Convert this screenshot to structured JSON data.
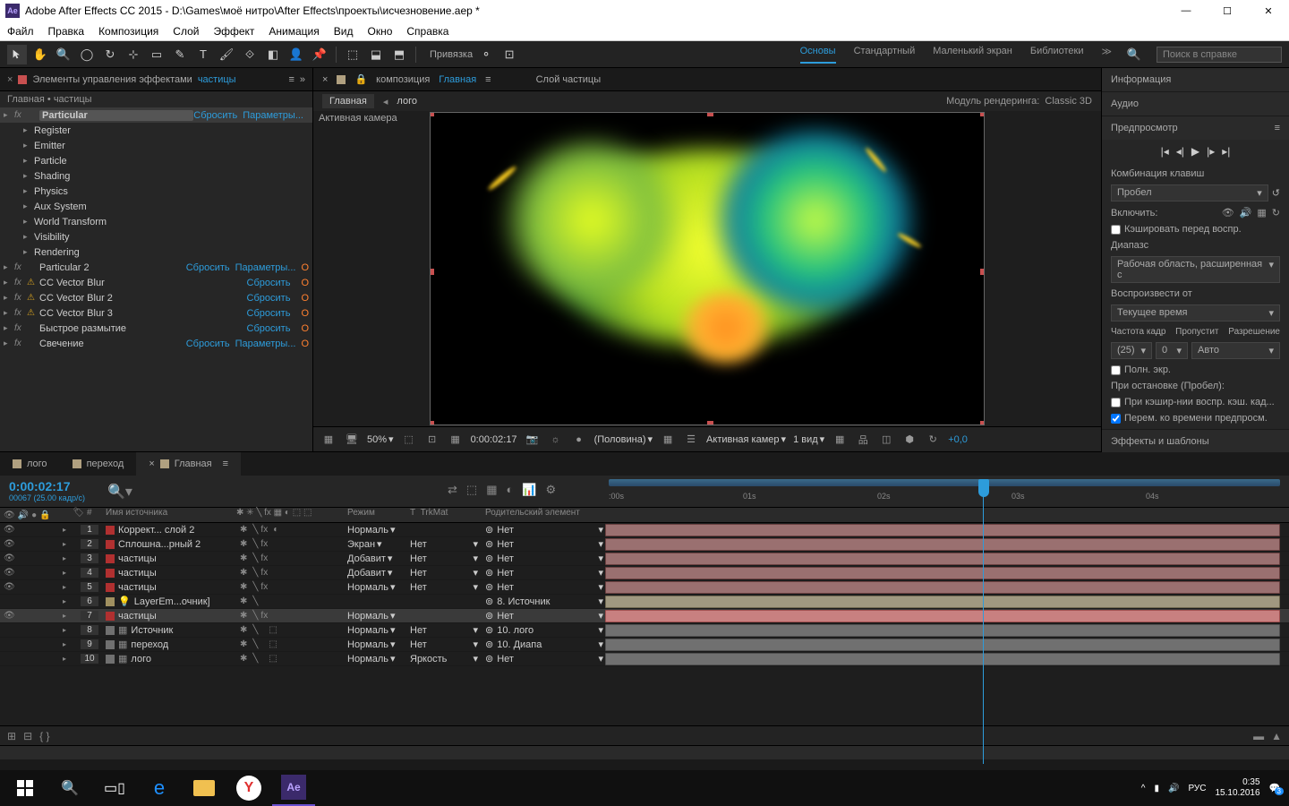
{
  "titlebar": {
    "app": "Adobe After Effects CC 2015",
    "path": "D:\\Games\\моё нитро\\After Effects\\проекты\\исчезновение.aep *"
  },
  "menu": [
    "Файл",
    "Правка",
    "Композиция",
    "Слой",
    "Эффект",
    "Анимация",
    "Вид",
    "Окно",
    "Справка"
  ],
  "toolrow": {
    "snap": "Привязка",
    "workspaces": [
      "Основы",
      "Стандартный",
      "Маленький экран",
      "Библиотеки"
    ],
    "ws_active": 0,
    "search_ph": "Поиск в справке"
  },
  "left": {
    "tab": "Элементы управления эффектами",
    "tab_target": "частицы",
    "crumb": "Главная • частицы",
    "fx": [
      {
        "name": "Particular",
        "bold": true,
        "warn": false,
        "reset": "Сбросить",
        "params": "Параметры...",
        "children": [
          "Register",
          "Emitter",
          "Particle",
          "Shading",
          "Physics",
          "Aux System",
          "World Transform",
          "Visibility",
          "Rendering"
        ]
      },
      {
        "name": "Particular 2",
        "warn": false,
        "reset": "Сбросить",
        "params": "Параметры..."
      },
      {
        "name": "CC Vector Blur",
        "warn": true,
        "reset": "Сбросить"
      },
      {
        "name": "CC Vector Blur 2",
        "warn": true,
        "reset": "Сбросить"
      },
      {
        "name": "CC Vector Blur 3",
        "warn": true,
        "reset": "Сбросить"
      },
      {
        "name": "Быстрое размытие",
        "warn": false,
        "reset": "Сбросить"
      },
      {
        "name": "Свечение",
        "warn": false,
        "reset": "Сбросить",
        "params": "Параметры..."
      }
    ]
  },
  "center": {
    "tab_prefix": "композиция",
    "tab_main": "Главная",
    "tab_layer": "Слой частицы",
    "flow_main": "Главная",
    "flow_logo": "лого",
    "renderer_lbl": "Модуль рендеринга:",
    "renderer": "Classic 3D",
    "cam": "Активная камера",
    "footer": {
      "zoom": "50%",
      "tc": "0:00:02:17",
      "res": "(Половина)",
      "cam": "Активная камер",
      "views": "1 вид",
      "exp": "+0,0"
    }
  },
  "right": {
    "info": "Информация",
    "audio": "Аудио",
    "preview": "Предпросмотр",
    "shortcut_lbl": "Комбинация клавиш",
    "shortcut": "Пробел",
    "include": "Включить:",
    "cache": "Кэшировать перед воспр.",
    "range_lbl": "Диапазс",
    "range": "Рабочая область, расширенная с",
    "playfrom_lbl": "Воспроизвести от",
    "playfrom": "Текущее время",
    "fps_lbl": "Частота кадр",
    "skip_lbl": "Пропустит",
    "res_lbl": "Разрешение",
    "fps": "(25)",
    "skip": "0",
    "res": "Авто",
    "fullscreen": "Полн. экр.",
    "onstop": "При остановке (Пробел):",
    "onstop1": "При кэшир-нии воспр. кэш. кад...",
    "onstop2": "Перем. ко времени предпросм.",
    "fx_templates": "Эффекты и шаблоны"
  },
  "timeline": {
    "tabs": [
      {
        "l": "лого"
      },
      {
        "l": "переход"
      },
      {
        "l": "Главная",
        "active": true
      }
    ],
    "tc": "0:00:02:17",
    "frame": "00067 (25.00 кадр/с)",
    "cols": {
      "src": "Имя источника",
      "mode": "Режим",
      "t": "T",
      "trk": "TrkMat",
      "parent": "Родительский элемент"
    },
    "ruler": [
      ":00s",
      "01s",
      "02s",
      "03s",
      "04s"
    ],
    "layers": [
      {
        "n": 1,
        "clr": "#b03030",
        "name": "Коррект... слой 2",
        "mode": "Нормаль",
        "trk": "",
        "parent": "Нет",
        "bar": "red",
        "vis": true
      },
      {
        "n": 2,
        "clr": "#b03030",
        "name": "Сплошна...рный 2",
        "mode": "Экран",
        "trk": "Нет",
        "parent": "Нет",
        "bar": "red",
        "vis": true
      },
      {
        "n": 3,
        "clr": "#b03030",
        "name": "частицы",
        "mode": "Добавит",
        "trk": "Нет",
        "parent": "Нет",
        "bar": "red",
        "vis": true
      },
      {
        "n": 4,
        "clr": "#b03030",
        "name": "частицы",
        "mode": "Добавит",
        "trk": "Нет",
        "parent": "Нет",
        "bar": "red",
        "vis": true
      },
      {
        "n": 5,
        "clr": "#b03030",
        "name": "частицы",
        "mode": "Нормаль",
        "trk": "Нет",
        "parent": "Нет",
        "bar": "red",
        "vis": true
      },
      {
        "n": 6,
        "clr": "#a09060",
        "name": "LayerEm...очник]",
        "mode": "",
        "trk": "",
        "parent": "8. Источник",
        "bar": "tan",
        "vis": false,
        "bulb": true
      },
      {
        "n": 7,
        "clr": "#b03030",
        "name": "частицы",
        "mode": "Нормаль",
        "trk": "",
        "parent": "Нет",
        "bar": "redsel",
        "vis": true,
        "sel": true
      },
      {
        "n": 8,
        "clr": "#707070",
        "name": "Источник",
        "mode": "Нормаль",
        "trk": "Нет",
        "parent": "10. лого",
        "bar": "gray",
        "vis": false,
        "comp": true
      },
      {
        "n": 9,
        "clr": "#707070",
        "name": "переход",
        "mode": "Нормаль",
        "trk": "Нет",
        "parent": "10. Диапа",
        "bar": "gray",
        "vis": false,
        "comp": true
      },
      {
        "n": 10,
        "clr": "#707070",
        "name": "лого",
        "mode": "Нормаль",
        "trk": "Яркость",
        "parent": "Нет",
        "bar": "gray",
        "vis": false,
        "comp": true
      }
    ]
  },
  "taskbar": {
    "lang": "РУС",
    "time": "0:35",
    "date": "15.10.2016",
    "notif": "3"
  }
}
